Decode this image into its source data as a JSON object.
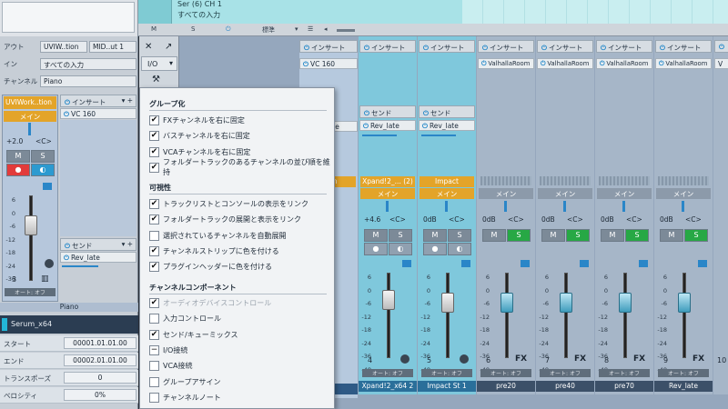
{
  "arrange_top": {
    "track_row1": "Ser (6)  CH 1",
    "track_row2": "すべての入力",
    "toolbar": {
      "m": "M",
      "s": "S",
      "standard": "標準"
    }
  },
  "inspector": {
    "out_label": "アウト",
    "out_value": "UVIW..tion",
    "out_value2": "MID..ut 1",
    "in_label": "イン",
    "in_value": "すべての入力",
    "channel_label": "チャンネル",
    "channel_value": "Piano",
    "strip_name": "UVIWork..tion",
    "main_label": "メイン",
    "volume": "+2.0",
    "pan": "<C>",
    "insert_head": "インサート",
    "insert_slot": "VC 160",
    "send_head": "センド",
    "send_slot": "Rev_late",
    "channel_number": "3",
    "automation": "オート: オフ",
    "track_name": "Piano",
    "fader_level": 0.72,
    "mute": "M",
    "solo": "S"
  },
  "event": {
    "name": "Serum_x64",
    "start_label": "スタート",
    "start_value": "00001.01.01.00",
    "end_label": "エンド",
    "end_value": "00002.01.01.00",
    "transpose_label": "トランスポーズ",
    "transpose_value": "0",
    "velocity_label": "ベロシティ",
    "velocity_value": "0%"
  },
  "mix_tools": {
    "io_label": "I/O"
  },
  "menu": {
    "group_heading": "グループ化",
    "group_items": [
      {
        "label": "FXチャンネルを右に固定",
        "checked": "✔"
      },
      {
        "label": "バスチャンネルを右に固定",
        "checked": "✔"
      },
      {
        "label": "VCAチャンネルを右に固定",
        "checked": "✔"
      },
      {
        "label": "フォルダートラックのあるチャンネルの並び順を維持",
        "checked": "✔"
      }
    ],
    "visibility_heading": "可視性",
    "visibility_items": [
      {
        "label": "トラックリストとコンソールの表示をリンク",
        "checked": "✔"
      },
      {
        "label": "フォルダートラックの展開と表示をリンク",
        "checked": "✔"
      },
      {
        "label": "選択されているチャンネルを自動展開",
        "checked": ""
      },
      {
        "label": "チャンネルストリップに色を付ける",
        "checked": "✔"
      },
      {
        "label": "プラグインヘッダーに色を付ける",
        "checked": "✔"
      }
    ],
    "component_heading": "チャンネルコンポーネント",
    "component_items": [
      {
        "label": "オーディオデバイスコントロール",
        "checked": "✔"
      },
      {
        "label": "入力コントロール",
        "checked": ""
      },
      {
        "label": "センド/キューミックス",
        "checked": "✔"
      },
      {
        "label": "I/O接続",
        "checked": "−"
      },
      {
        "label": "VCA接続",
        "checked": ""
      },
      {
        "label": "グループアサイン",
        "checked": ""
      },
      {
        "label": "チャンネルノート",
        "checked": ""
      }
    ]
  },
  "mixer": {
    "insert_head": "インサート",
    "send_head": "センド",
    "main_label": "メイン",
    "automation": "オート: オフ",
    "fx_label": "FX",
    "partial_strip": {
      "insert_slot": "VC 160",
      "send_slot": "Rev_late",
      "name_fragment": "..tion",
      "track_name_fragment": "o"
    },
    "strips": [
      {
        "name": "Xpand!2_... (2)",
        "track_name": "Xpand!2_x64 2",
        "volume": "+4.6",
        "pan": "<C>",
        "number": "4",
        "send_slot": "Rev_late",
        "solo_on": false,
        "fader_level": 0.76
      },
      {
        "name": "Impact",
        "track_name": "Impact St 1",
        "volume": "0dB",
        "pan": "<C>",
        "number": "5",
        "send_slot": "Rev_late",
        "solo_on": false,
        "fader_level": 0.72
      },
      {
        "name": "",
        "track_name": "pre20",
        "volume": "0dB",
        "pan": "<C>",
        "number": "6",
        "insert_slot": "ValhallaRoom",
        "solo_on": true,
        "fader_level": 0.72
      },
      {
        "name": "",
        "track_name": "pre40",
        "volume": "0dB",
        "pan": "<C>",
        "number": "7",
        "insert_slot": "ValhallaRoom",
        "solo_on": true,
        "fader_level": 0.72
      },
      {
        "name": "",
        "track_name": "pre70",
        "volume": "0dB",
        "pan": "<C>",
        "number": "8",
        "insert_slot": "ValhallaRoom",
        "solo_on": true,
        "fader_level": 0.72
      },
      {
        "name": "",
        "track_name": "Rev_late",
        "volume": "0dB",
        "pan": "<C>",
        "number": "9",
        "insert_slot": "ValhallaRoom",
        "solo_on": true,
        "fader_level": 0.72
      }
    ],
    "edge_strip": {
      "number": "10",
      "insert_slot": "V"
    }
  },
  "colors": {
    "accent_gold": "#e3a429",
    "accent_cyan": "#2aa9d2",
    "solo_green": "#27a845",
    "record_red": "#e23b3b"
  }
}
